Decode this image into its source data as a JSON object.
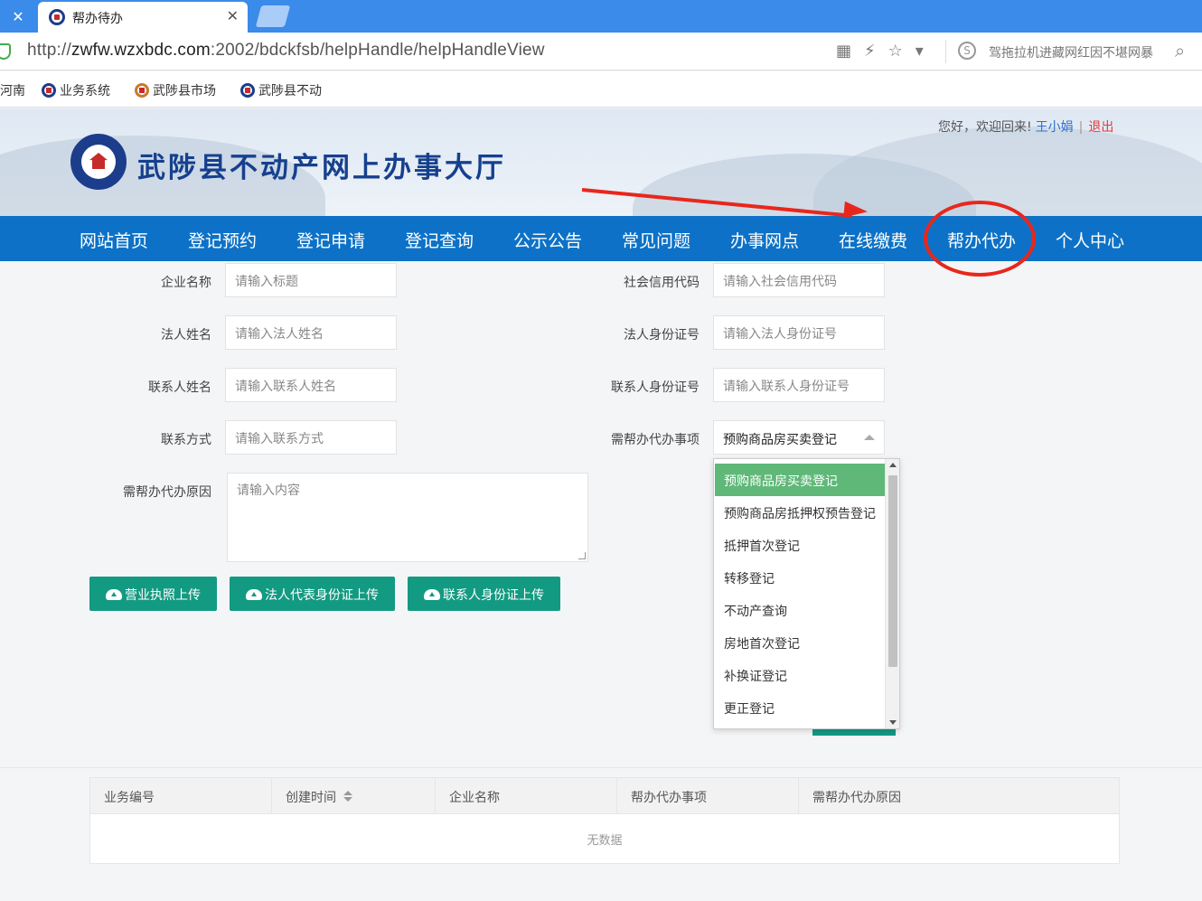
{
  "browser": {
    "tab_title": "帮办待办",
    "url_prefix": "http://",
    "url_host": "zwfw.wzxbdc.com",
    "url_rest": ":2002/bdckfsb/helpHandle/helpHandleView",
    "search_hint": "驾拖拉机进藏网红因不堪网暴"
  },
  "bookmarks": [
    {
      "label": "河南"
    },
    {
      "label": "业务系统"
    },
    {
      "label": "武陟县市场"
    },
    {
      "label": "武陟县不动"
    }
  ],
  "header": {
    "title": "武陟县不动产网上办事大厅",
    "greeting": "您好，欢迎回来!",
    "user": "王小娟",
    "separator": "|",
    "logout": "退出"
  },
  "nav": [
    {
      "label": "网站首页"
    },
    {
      "label": "登记预约"
    },
    {
      "label": "登记申请"
    },
    {
      "label": "登记查询"
    },
    {
      "label": "公示公告"
    },
    {
      "label": "常见问题"
    },
    {
      "label": "办事网点"
    },
    {
      "label": "在线缴费"
    },
    {
      "label": "帮办代办"
    },
    {
      "label": "个人中心"
    }
  ],
  "form": {
    "company_name": {
      "label": "企业名称",
      "placeholder": "请输入标题"
    },
    "credit_code": {
      "label": "社会信用代码",
      "placeholder": "请输入社会信用代码"
    },
    "legal_name": {
      "label": "法人姓名",
      "placeholder": "请输入法人姓名"
    },
    "legal_id": {
      "label": "法人身份证号",
      "placeholder": "请输入法人身份证号"
    },
    "contact_name": {
      "label": "联系人姓名",
      "placeholder": "请输入联系人姓名"
    },
    "contact_id": {
      "label": "联系人身份证号",
      "placeholder": "请输入联系人身份证号"
    },
    "contact_phone": {
      "label": "联系方式",
      "placeholder": "请输入联系方式"
    },
    "matter": {
      "label": "需帮办代办事项",
      "value": "预购商品房买卖登记"
    },
    "reason": {
      "label": "需帮办代办原因",
      "placeholder": "请输入内容"
    }
  },
  "uploads": [
    {
      "label": "营业执照上传"
    },
    {
      "label": "法人代表身份证上传"
    },
    {
      "label": "联系人身份证上传"
    }
  ],
  "dropdown": {
    "options": [
      "预购商品房买卖登记",
      "预购商品房抵押权预告登记",
      "抵押首次登记",
      "转移登记",
      "不动产查询",
      "房地首次登记",
      "补换证登记",
      "更正登记"
    ],
    "selected_index": 0
  },
  "table": {
    "columns": [
      "业务编号",
      "创建时间",
      "企业名称",
      "帮办代办事项",
      "需帮办代办原因"
    ],
    "empty_text": "无数据"
  },
  "colors": {
    "nav_bg": "#0d72c7",
    "primary_button": "#139a82",
    "selected_option": "#5fb878",
    "annotation": "#e8271c"
  }
}
